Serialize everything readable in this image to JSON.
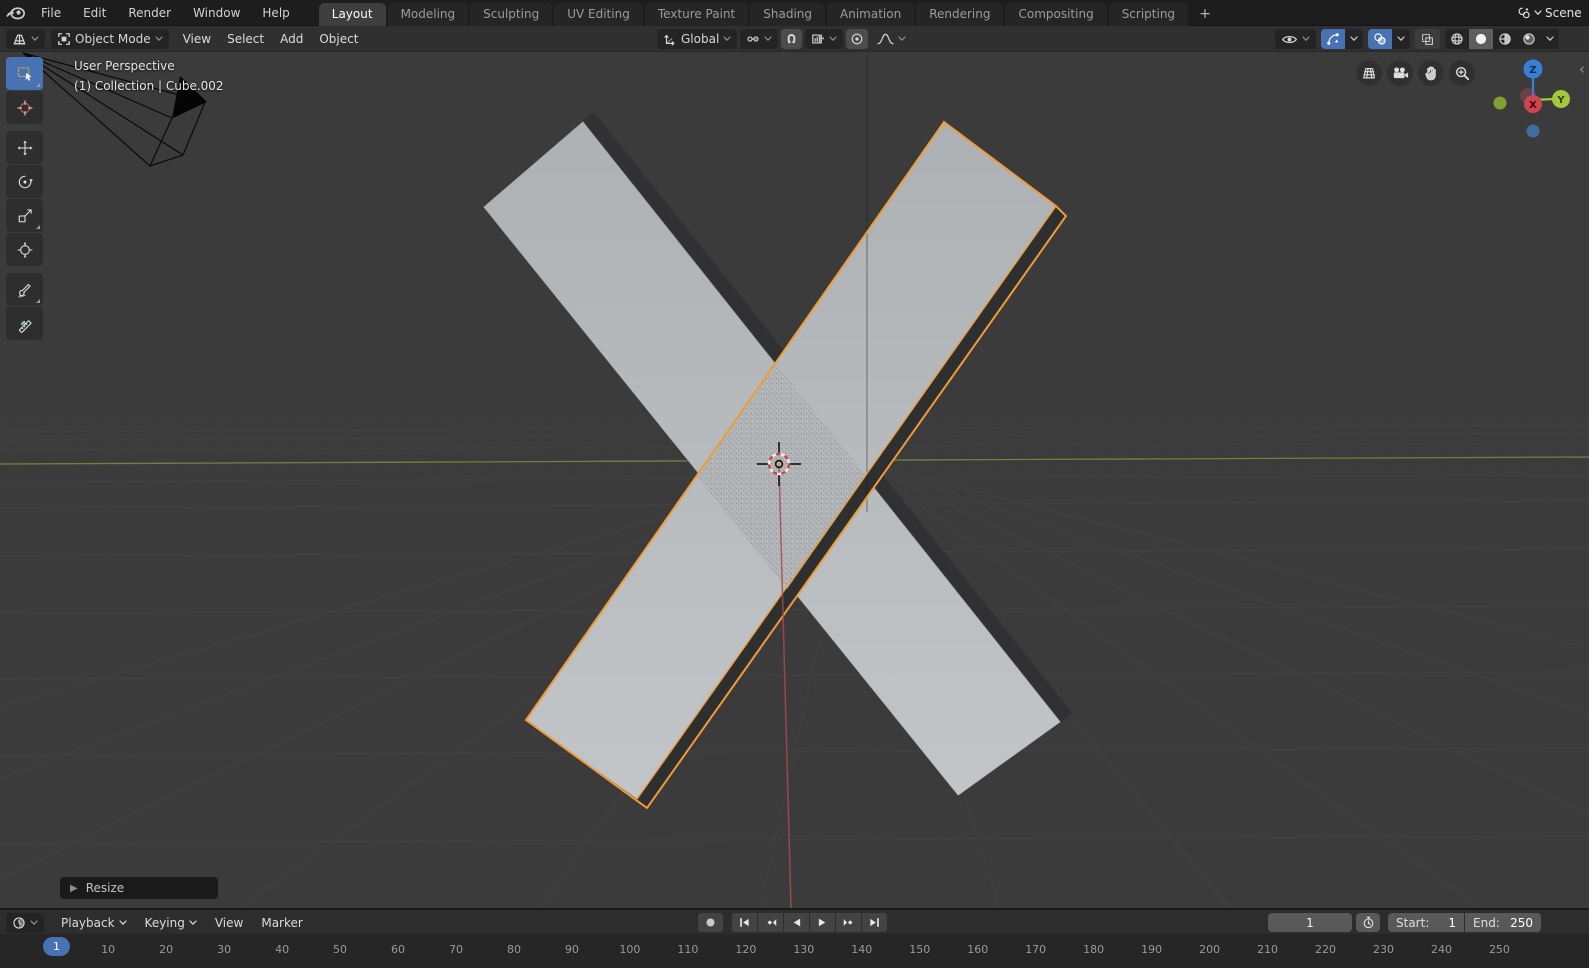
{
  "topbar": {
    "logo_icon": "blender-logo-icon",
    "menus": [
      "File",
      "Edit",
      "Render",
      "Window",
      "Help"
    ],
    "tabs": [
      {
        "label": "Layout",
        "active": true
      },
      {
        "label": "Modeling",
        "active": false
      },
      {
        "label": "Sculpting",
        "active": false
      },
      {
        "label": "UV Editing",
        "active": false
      },
      {
        "label": "Texture Paint",
        "active": false
      },
      {
        "label": "Shading",
        "active": false
      },
      {
        "label": "Animation",
        "active": false
      },
      {
        "label": "Rendering",
        "active": false
      },
      {
        "label": "Compositing",
        "active": false
      },
      {
        "label": "Scripting",
        "active": false
      }
    ],
    "new_workspace_label": "+",
    "scene_selector": {
      "icon": "scene-icon",
      "label": "Scene"
    }
  },
  "viewport_header": {
    "editor_type_icon": "3d-viewport-icon",
    "mode": {
      "icon": "object-mode-icon",
      "label": "Object Mode"
    },
    "menus": [
      "View",
      "Select",
      "Add",
      "Object"
    ],
    "transform_orientation": {
      "icon": "orientation-globe-icon",
      "label": "Global"
    },
    "pivot_icon": "pivot-point-icon",
    "snap_toggle_icon": "magnet-icon",
    "snap_with_icon": "snap-increment-icon",
    "proportional_icon": "proportional-editing-icon",
    "falloff_icon": "falloff-curve-icon",
    "right": {
      "visibility_icon": "eye-icon",
      "gizmos_icon": "gizmo-icon",
      "overlays_icon": "overlays-icon",
      "xray_icon": "xray-icon",
      "shading_modes": [
        {
          "name": "wireframe",
          "active": false
        },
        {
          "name": "solid",
          "active": true
        },
        {
          "name": "material",
          "active": false
        },
        {
          "name": "rendered",
          "active": false
        }
      ]
    }
  },
  "toolbar": {
    "tools": [
      {
        "name": "select-box",
        "active": true,
        "submenu": true,
        "group_break": false
      },
      {
        "name": "cursor",
        "active": false,
        "submenu": false,
        "group_break": false
      },
      {
        "name": "move",
        "active": false,
        "submenu": false,
        "group_break": true
      },
      {
        "name": "rotate",
        "active": false,
        "submenu": false,
        "group_break": false
      },
      {
        "name": "scale",
        "active": false,
        "submenu": true,
        "group_break": false
      },
      {
        "name": "transform",
        "active": false,
        "submenu": false,
        "group_break": false
      },
      {
        "name": "annotate",
        "active": false,
        "submenu": true,
        "group_break": true
      },
      {
        "name": "measure",
        "active": false,
        "submenu": false,
        "group_break": false
      }
    ]
  },
  "viewport": {
    "overlay_title": "User Perspective",
    "overlay_subtitle": "(1) Collection | Cube.002",
    "nav_buttons": [
      {
        "name": "grid-projection"
      },
      {
        "name": "camera-view"
      },
      {
        "name": "pan-view"
      },
      {
        "name": "zoom-view"
      }
    ],
    "gizmo": {
      "x": "X",
      "y": "Y",
      "z": "Z"
    },
    "collapse_chevron": "‹"
  },
  "operator_panel": {
    "label": "Resize"
  },
  "timeline": {
    "editor_icon": "clock-icon",
    "menus": [
      {
        "label": "Playback",
        "caret": true
      },
      {
        "label": "Keying",
        "caret": true
      },
      {
        "label": "View",
        "caret": false
      },
      {
        "label": "Marker",
        "caret": false
      }
    ],
    "transport": [
      "record",
      "jumpstart",
      "prevkey",
      "revplay",
      "play",
      "nextkey",
      "jumpend"
    ],
    "current_frame": "1",
    "start_label": "Start:",
    "start_value": "1",
    "end_label": "End:",
    "end_value": "250",
    "ruler_frames": [
      10,
      20,
      30,
      40,
      50,
      60,
      70,
      80,
      90,
      100,
      110,
      120,
      130,
      140,
      150,
      160,
      170,
      180,
      190,
      200,
      210,
      220,
      230,
      240,
      250
    ]
  },
  "colors": {
    "accent_blue": "#4772b3",
    "selection_orange": "#f09b37",
    "axis_green": "#6e8b3d",
    "axis_red": "#a84b4b",
    "gizmo_z_blue": "#3a7fd5",
    "gizmo_y_green": "#a3c83c",
    "gizmo_x_red": "#cf4454",
    "object_gray": "#b3b6b8",
    "viewport_bg": "#3b3b3b"
  }
}
